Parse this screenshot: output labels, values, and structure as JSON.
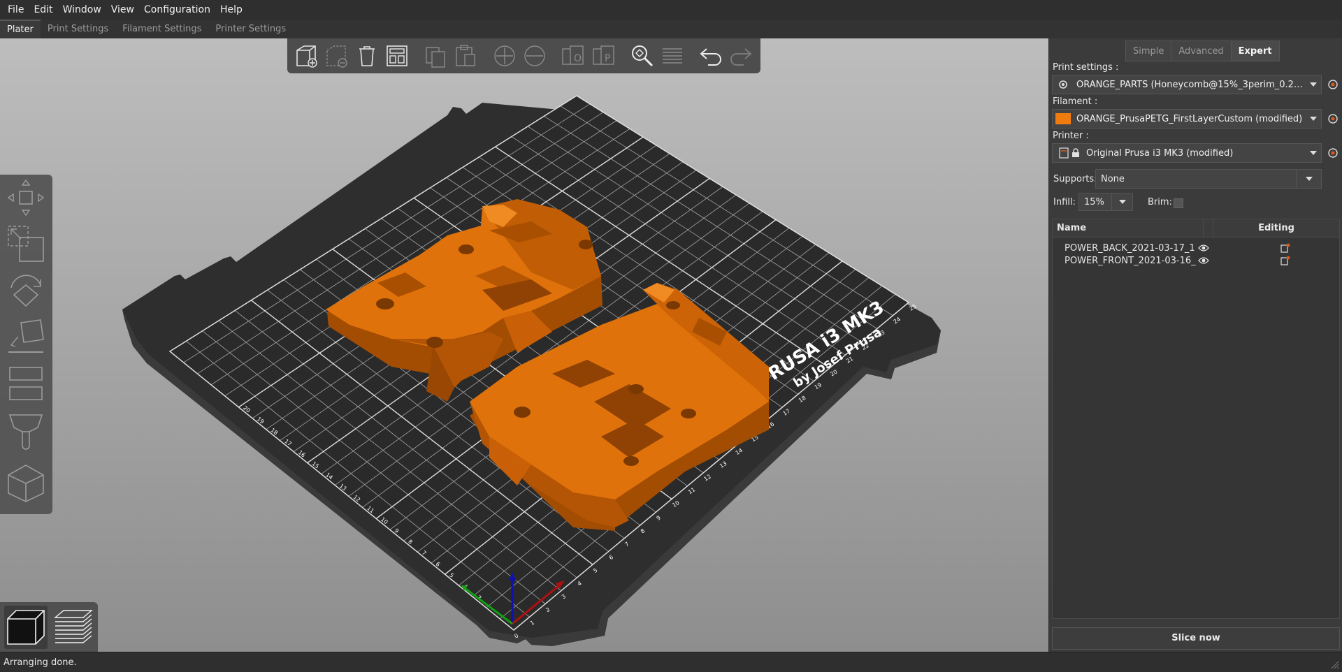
{
  "menu": [
    "File",
    "Edit",
    "Window",
    "View",
    "Configuration",
    "Help"
  ],
  "tabs": [
    {
      "label": "Plater",
      "active": true
    },
    {
      "label": "Print Settings",
      "active": false
    },
    {
      "label": "Filament Settings",
      "active": false
    },
    {
      "label": "Printer Settings",
      "active": false
    }
  ],
  "mode_tabs": [
    {
      "label": "Simple",
      "active": false
    },
    {
      "label": "Advanced",
      "active": false
    },
    {
      "label": "Expert",
      "active": true
    }
  ],
  "print_settings": {
    "label": "Print settings :",
    "value": "ORANGE_PARTS (Honeycomb@15%_3perim_0.2…"
  },
  "filament": {
    "label": "Filament :",
    "value": "ORANGE_PrusaPETG_FirstLayerCustom (modified)",
    "color": "#f07b0f"
  },
  "printer": {
    "label": "Printer :",
    "value": "Original Prusa i3 MK3 (modified)"
  },
  "supports": {
    "label": "Supports:",
    "value": "None"
  },
  "infill": {
    "label": "Infill:",
    "value": "15%"
  },
  "brim": {
    "label": "Brim:",
    "checked": false
  },
  "object_list": {
    "columns": [
      "Name",
      "Editing"
    ],
    "rows": [
      {
        "name": "POWER_BACK_2021-03-17_1"
      },
      {
        "name": "POWER_FRONT_2021-03-16_"
      }
    ]
  },
  "slice_button": "Slice now",
  "status": "Arranging done.",
  "bed": {
    "title": "PRUSA i3 MK3",
    "subtitle": "by Josef Prusa",
    "ruler_labels": [
      "0",
      "1",
      "2",
      "3",
      "4",
      "5",
      "6",
      "7",
      "8",
      "9",
      "10",
      "11",
      "12",
      "13",
      "14",
      "15",
      "16",
      "17",
      "18",
      "19",
      "20",
      "21",
      "22",
      "23",
      "24",
      "25"
    ],
    "left_ruler_labels": [
      "3",
      "4",
      "5",
      "6",
      "7",
      "8",
      "9",
      "10",
      "11",
      "12",
      "13",
      "14",
      "15",
      "16",
      "17",
      "18",
      "19",
      "20"
    ]
  },
  "colors": {
    "part_orange": "#d96a06",
    "bed_dark": "#2f2f2f",
    "panel_bg": "#3b3b3b"
  }
}
